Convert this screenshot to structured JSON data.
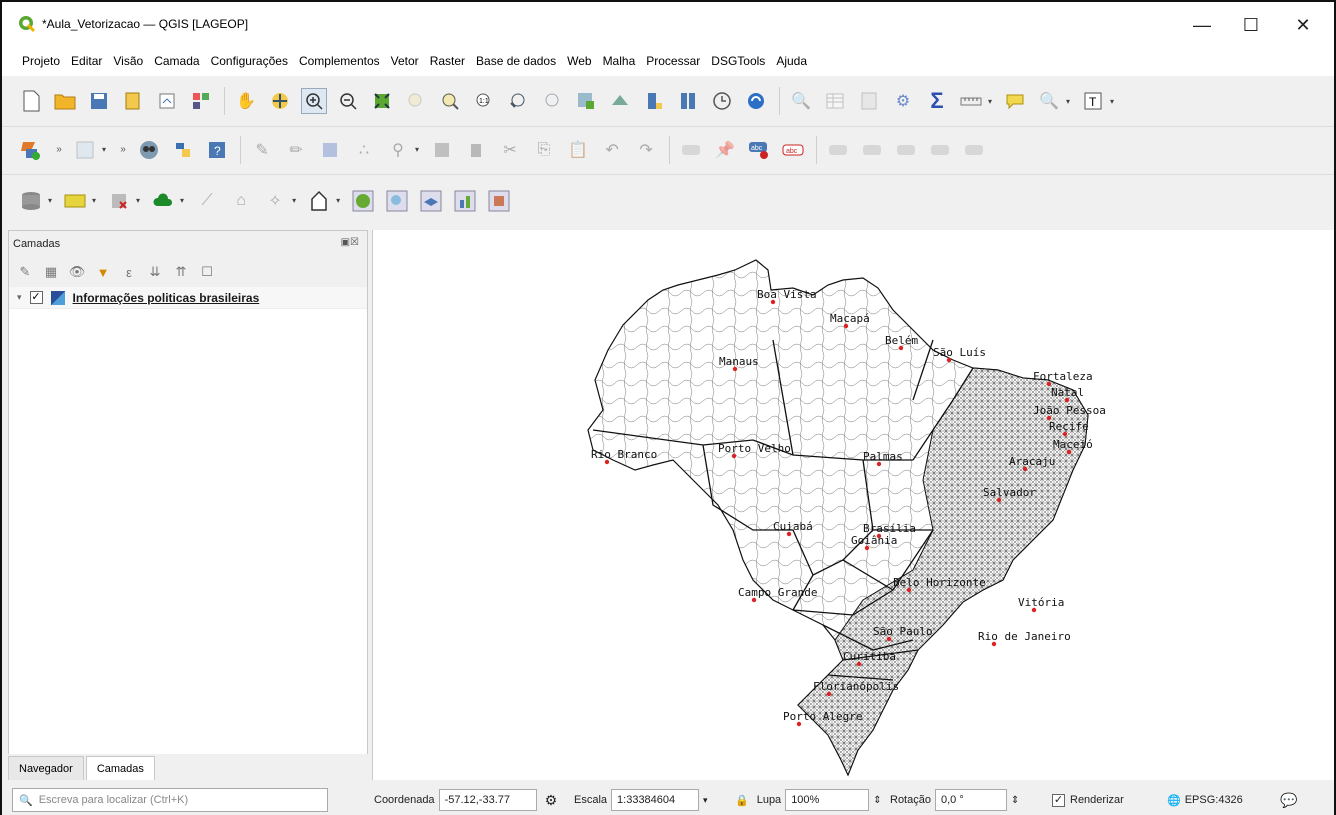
{
  "window": {
    "title": "*Aula_Vetorizacao — QGIS [LAGEOP]",
    "controls": [
      "—",
      "☐",
      "✕"
    ]
  },
  "menu": [
    "Projeto",
    "Editar",
    "Visão",
    "Camada",
    "Configurações",
    "Complementos",
    "Vetor",
    "Raster",
    "Base de dados",
    "Web",
    "Malha",
    "Processar",
    "DSGTools",
    "Ajuda"
  ],
  "layers_panel": {
    "title": "Camadas",
    "layer_name": "Informações politicas brasileiras",
    "layer_checked": true
  },
  "bottom_tabs": [
    "Navegador",
    "Camadas"
  ],
  "search": {
    "placeholder": "Escreva para localizar (Ctrl+K)"
  },
  "status": {
    "coord_label": "Coordenada",
    "coord_value": "-57.12,-33.77",
    "scale_label": "Escala",
    "scale_value": "1:33384604",
    "magnifier_label": "Lupa",
    "magnifier_value": "100%",
    "rotation_label": "Rotação",
    "rotation_value": "0,0 °",
    "render_label": "Renderizar",
    "render_checked": true,
    "crs": "EPSG:4326"
  },
  "map": {
    "cities": [
      "Boa Vista",
      "Macapá",
      "Belém",
      "São Luís",
      "Manaus",
      "Fortaleza",
      "Natal",
      "João Pessoa",
      "Recife",
      "Maceió",
      "Aracaju",
      "Palmas",
      "Porto Velho",
      "Rio Branco",
      "Salvador",
      "Cuiabá",
      "Brasília",
      "Goiânia",
      "Belo Horizonte",
      "Campo Grande",
      "Vitória",
      "São Paulo",
      "Rio de Janeiro",
      "Curitiba",
      "Florianópolis",
      "Porto Alegre"
    ]
  },
  "colors": {
    "accent": "#3b7d23",
    "city_dot": "#d22"
  }
}
